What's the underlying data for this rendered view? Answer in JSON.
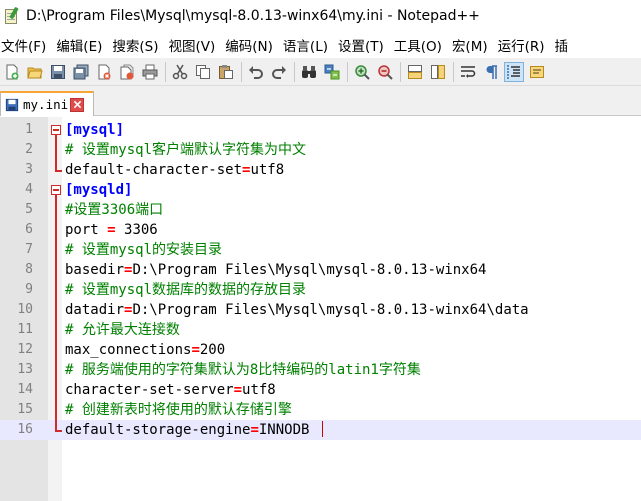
{
  "window": {
    "title": "D:\\Program Files\\Mysql\\mysql-8.0.13-winx64\\my.ini - Notepad++"
  },
  "menu": [
    "文件(F)",
    "编辑(E)",
    "搜索(S)",
    "视图(V)",
    "编码(N)",
    "语言(L)",
    "设置(T)",
    "工具(O)",
    "宏(M)",
    "运行(R)",
    "插"
  ],
  "toolbar": [
    "new-file",
    "open-file",
    "save",
    "save-all",
    "close",
    "close-all",
    "print",
    "cut",
    "copy",
    "paste",
    "undo",
    "redo",
    "find",
    "replace",
    "zoom-in",
    "zoom-out",
    "sync-vertical",
    "sync-horizontal",
    "word-wrap",
    "show-all-chars",
    "indent-guide",
    "user-define"
  ],
  "tab": {
    "label": "my.ini"
  },
  "editor": {
    "lines": [
      {
        "n": "1",
        "type": "section",
        "text": "[mysql]"
      },
      {
        "n": "2",
        "type": "comment",
        "text": "# 设置mysql客户端默认字符集为中文"
      },
      {
        "n": "3",
        "type": "kv",
        "key": "default-character-set",
        "value": "utf8"
      },
      {
        "n": "4",
        "type": "section",
        "text": "[mysqld]"
      },
      {
        "n": "5",
        "type": "comment",
        "text": "#设置3306端口"
      },
      {
        "n": "6",
        "type": "kv",
        "key": "port ",
        "value": " 3306"
      },
      {
        "n": "7",
        "type": "comment",
        "text": "# 设置mysql的安装目录"
      },
      {
        "n": "8",
        "type": "kv",
        "key": "basedir",
        "value": "D:\\Program Files\\Mysql\\mysql-8.0.13-winx64"
      },
      {
        "n": "9",
        "type": "comment",
        "text": "# 设置mysql数据库的数据的存放目录"
      },
      {
        "n": "10",
        "type": "kv",
        "key": "datadir",
        "value": "D:\\Program Files\\Mysql\\mysql-8.0.13-winx64\\data"
      },
      {
        "n": "11",
        "type": "comment",
        "text": "# 允许最大连接数"
      },
      {
        "n": "12",
        "type": "kv",
        "key": "max_connections",
        "value": "200"
      },
      {
        "n": "13",
        "type": "comment",
        "text": "# 服务端使用的字符集默认为8比特编码的latin1字符集"
      },
      {
        "n": "14",
        "type": "kv",
        "key": "character-set-server",
        "value": "utf8"
      },
      {
        "n": "15",
        "type": "comment",
        "text": "# 创建新表时将使用的默认存储引擎"
      },
      {
        "n": "16",
        "type": "kv",
        "key": "default-storage-engine",
        "value": "INNODB "
      }
    ],
    "current_line": "16"
  },
  "colors": {
    "section": "#0000ff",
    "comment": "#008000",
    "operator": "#ff0000",
    "fold": "#d12a2a",
    "current_line_bg": "#e8e8ff",
    "gutter_bg": "#e4e4e4"
  }
}
